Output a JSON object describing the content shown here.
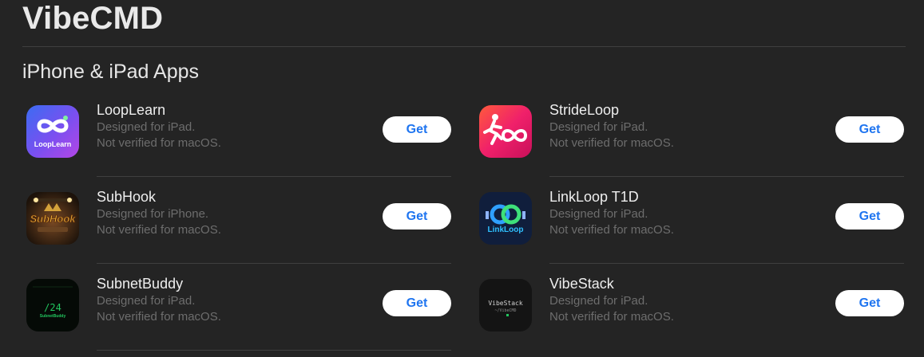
{
  "developer": {
    "title": "VibeCMD"
  },
  "section": {
    "title": "iPhone & iPad Apps"
  },
  "apps": [
    {
      "name": "LoopLearn",
      "designed": "Designed for iPad.",
      "verified": "Not verified for macOS.",
      "button": "Get",
      "icon": "looplearn-icon",
      "icon_text": "LoopLearn"
    },
    {
      "name": "StrideLoop",
      "designed": "Designed for iPad.",
      "verified": "Not verified for macOS.",
      "button": "Get",
      "icon": "strideloop-icon"
    },
    {
      "name": "SubHook",
      "designed": "Designed for iPhone.",
      "verified": "Not verified for macOS.",
      "button": "Get",
      "icon": "subhook-icon",
      "icon_text": "SubHook"
    },
    {
      "name": "LinkLoop T1D",
      "designed": "Designed for iPad.",
      "verified": "Not verified for macOS.",
      "button": "Get",
      "icon": "linkloop-icon",
      "icon_text": "LinkLoop"
    },
    {
      "name": "SubnetBuddy",
      "designed": "Designed for iPad.",
      "verified": "Not verified for macOS.",
      "button": "Get",
      "icon": "subnetbuddy-icon",
      "icon_text": "/24",
      "icon_subtext": "SubnetBuddy"
    },
    {
      "name": "VibeStack",
      "designed": "Designed for iPad.",
      "verified": "Not verified for macOS.",
      "button": "Get",
      "icon": "vibestack-icon",
      "icon_text": "VibeStack",
      "icon_subtext": "~/VibeCMD"
    }
  ],
  "colors": {
    "background": "#242424",
    "button_text": "#1f75f0",
    "button_bg": "#ffffff",
    "secondary_text": "#6d6d6d"
  }
}
